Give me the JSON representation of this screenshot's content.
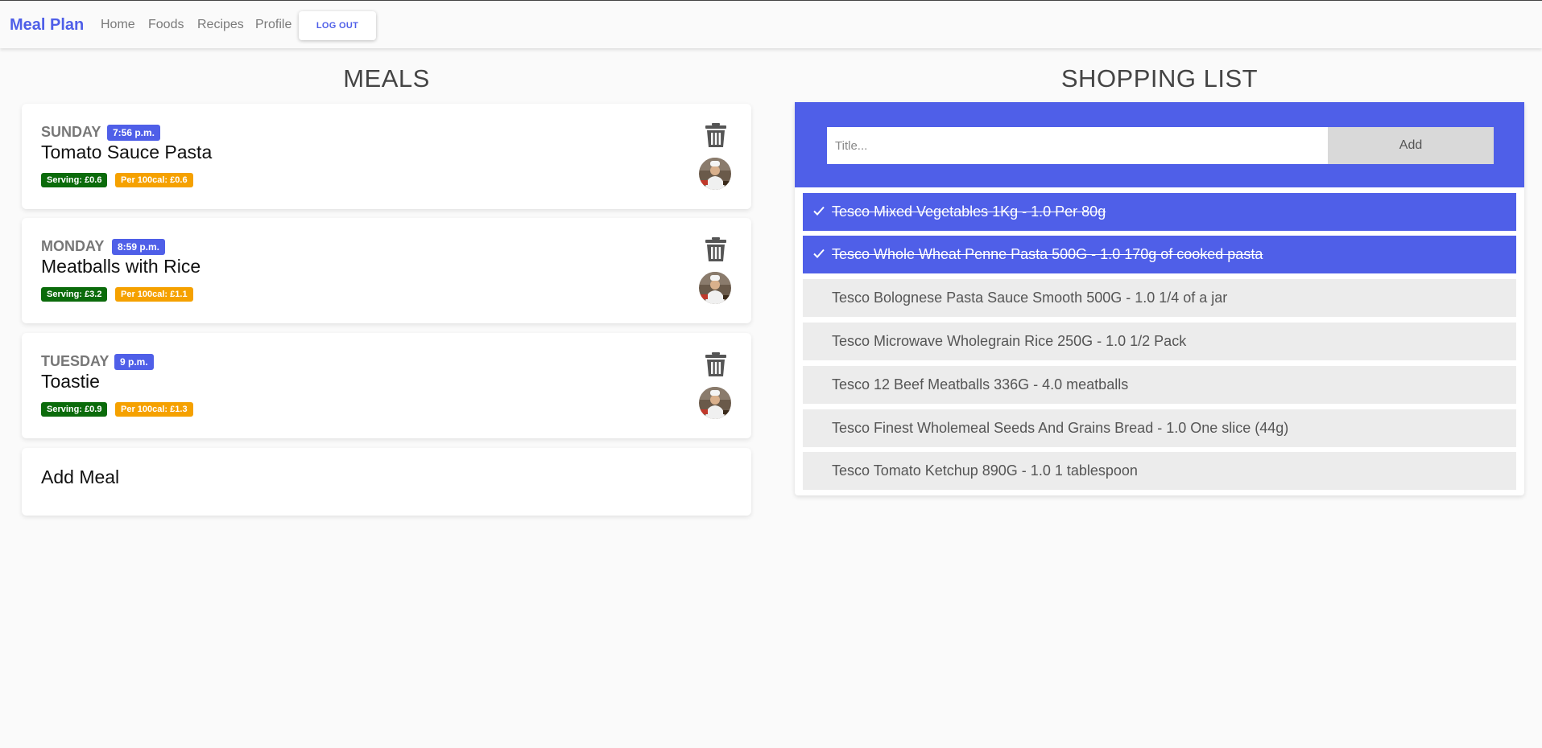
{
  "nav": {
    "brand": "Meal Plan",
    "links": [
      "Home",
      "Foods",
      "Recipes",
      "Profile"
    ],
    "logout": "LOG OUT"
  },
  "meals": {
    "title": "MEALS",
    "items": [
      {
        "day": "SUNDAY",
        "time": "7:56 p.m.",
        "name": "Tomato Sauce Pasta",
        "serving": "Serving: £0.6",
        "per100": "Per 100cal: £0.6"
      },
      {
        "day": "MONDAY",
        "time": "8:59 p.m.",
        "name": "Meatballs with Rice",
        "serving": "Serving: £3.2",
        "per100": "Per 100cal: £1.1"
      },
      {
        "day": "TUESDAY",
        "time": "9 p.m.",
        "name": "Toastie",
        "serving": "Serving: £0.9",
        "per100": "Per 100cal: £1.3"
      }
    ],
    "add_label": "Add Meal"
  },
  "shopping": {
    "title": "SHOPPING LIST",
    "input_placeholder": "Title...",
    "add_label": "Add",
    "items": [
      {
        "text": "Tesco Mixed Vegetables 1Kg - 1.0 Per 80g",
        "checked": true
      },
      {
        "text": "Tesco Whole Wheat Penne Pasta 500G - 1.0 170g of cooked pasta",
        "checked": true
      },
      {
        "text": "Tesco Bolognese Pasta Sauce Smooth 500G - 1.0 1/4 of a jar",
        "checked": false
      },
      {
        "text": "Tesco Microwave Wholegrain Rice 250G - 1.0 1/2 Pack",
        "checked": false
      },
      {
        "text": "Tesco 12 Beef Meatballs 336G - 4.0 meatballs",
        "checked": false
      },
      {
        "text": "Tesco Finest Wholemeal Seeds And Grains Bread - 1.0 One slice (44g)",
        "checked": false
      },
      {
        "text": "Tesco Tomato Ketchup 890G - 1.0 1 tablespoon",
        "checked": false
      }
    ]
  },
  "colors": {
    "accent": "#4f5fe8",
    "serving_badge": "#0b6b0b",
    "per100_badge": "#f5a100",
    "unchecked_item": "#ececec"
  }
}
